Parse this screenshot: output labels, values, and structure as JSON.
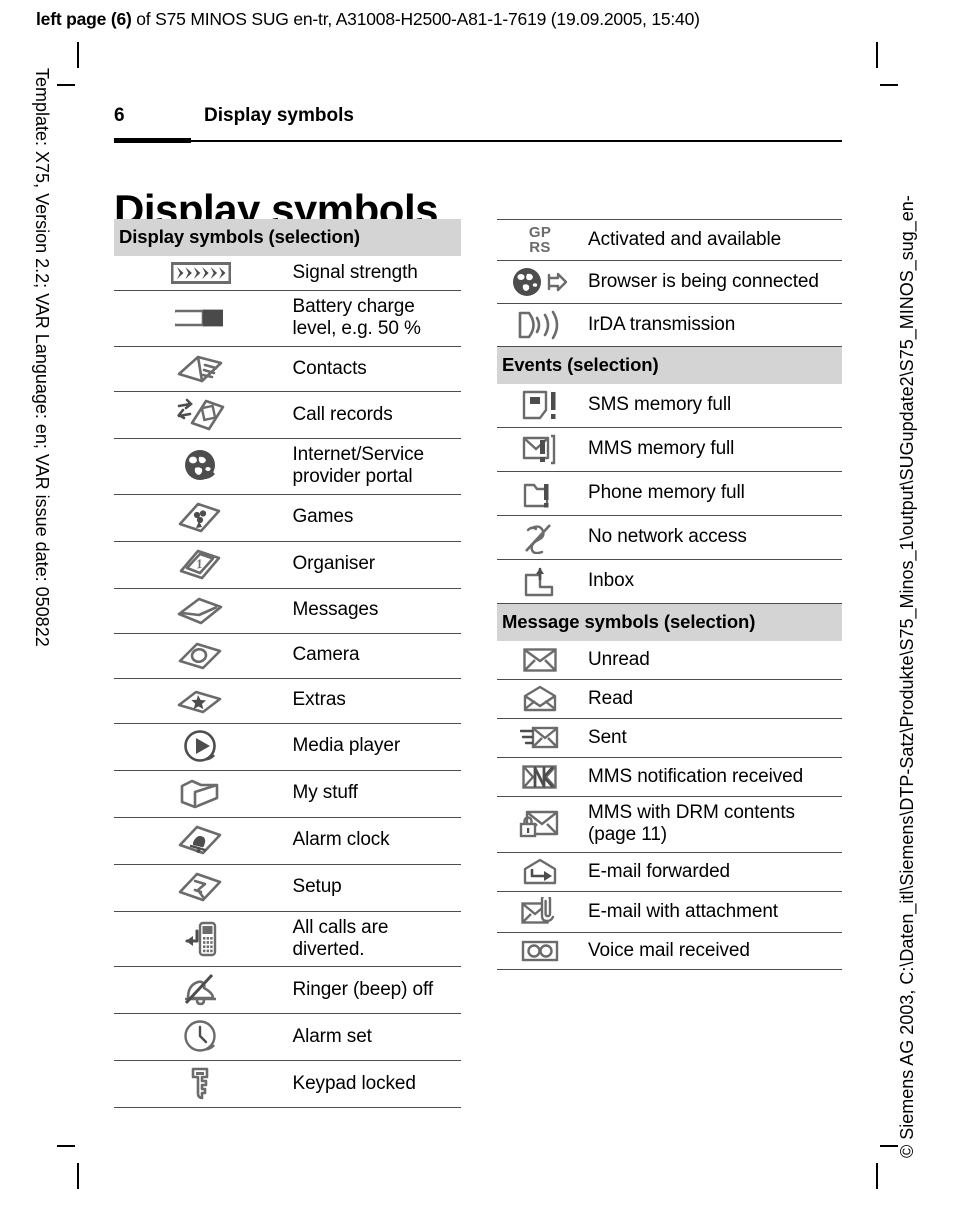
{
  "print_header": {
    "bold_prefix": "left page (6)",
    "rest": " of S75 MINOS SUG en-tr, A31008-H2500-A81-1-7619 (19.09.2005, 15:40)"
  },
  "side_text": {
    "left": "Template: X75, Version 2.2; VAR Language: en; VAR issue date: 050822",
    "right": "© Siemens AG 2003, C:\\Daten_itl\\Siemens\\DTP-Satz\\Produkte\\S75_Minos_1\\output\\SUGupdate2\\S75_MINOS_sug_en-"
  },
  "running_head": {
    "page_number": "6",
    "title": "Display symbols"
  },
  "chapter_title": "Display symbols",
  "colors": {
    "section_band": "#d4d4d4",
    "rule": "#4d4d4d",
    "icon_gray": "#6b6b6b",
    "icon_dark": "#4d4d4d"
  },
  "left_column": {
    "sections": [
      {
        "heading": "Display symbols (selection)",
        "rows": [
          {
            "icon": "signal-strength-icon",
            "label": "Signal strength"
          },
          {
            "icon": "battery-half-icon",
            "label": "Battery charge level, e.g. 50 %"
          },
          {
            "icon": "contacts-icon",
            "label": "Contacts"
          },
          {
            "icon": "call-records-icon",
            "label": "Call records"
          },
          {
            "icon": "globe-icon",
            "label": "Internet/Service provider portal"
          },
          {
            "icon": "games-icon",
            "label": "Games"
          },
          {
            "icon": "organiser-icon",
            "label": "Organiser"
          },
          {
            "icon": "messages-icon",
            "label": "Messages"
          },
          {
            "icon": "camera-icon",
            "label": "Camera"
          },
          {
            "icon": "extras-icon",
            "label": "Extras"
          },
          {
            "icon": "media-player-icon",
            "label": "Media player"
          },
          {
            "icon": "my-stuff-icon",
            "label": "My stuff"
          },
          {
            "icon": "alarm-clock-icon",
            "label": "Alarm clock"
          },
          {
            "icon": "setup-icon",
            "label": "Setup"
          },
          {
            "icon": "call-diverted-icon",
            "label": "All calls are diverted."
          },
          {
            "icon": "ringer-off-icon",
            "label": "Ringer (beep) off"
          },
          {
            "icon": "alarm-set-icon",
            "label": "Alarm set"
          },
          {
            "icon": "keypad-locked-icon",
            "label": "Keypad locked"
          }
        ]
      }
    ]
  },
  "right_column": {
    "sections": [
      {
        "heading": null,
        "rows": [
          {
            "icon": "gprs-icon",
            "icon_text": "GP\nRS",
            "label": "Activated and available"
          },
          {
            "icon": "browser-connecting-icon",
            "label": "Browser is being connected"
          },
          {
            "icon": "irda-icon",
            "label": "IrDA transmission"
          }
        ]
      },
      {
        "heading": "Events (selection)",
        "rows": [
          {
            "icon": "sms-memory-full-icon",
            "label": "SMS memory full"
          },
          {
            "icon": "mms-memory-full-icon",
            "label": "MMS memory full"
          },
          {
            "icon": "phone-memory-full-icon",
            "label": "Phone memory full"
          },
          {
            "icon": "no-network-icon",
            "label": "No network access"
          },
          {
            "icon": "inbox-icon",
            "label": "Inbox"
          }
        ]
      },
      {
        "heading": "Message symbols (selection)",
        "rows": [
          {
            "icon": "unread-envelope-icon",
            "label": "Unread"
          },
          {
            "icon": "read-envelope-icon",
            "label": "Read"
          },
          {
            "icon": "sent-envelope-icon",
            "label": "Sent"
          },
          {
            "icon": "mms-notification-icon",
            "label": "MMS notification received"
          },
          {
            "icon": "mms-drm-icon",
            "label": "MMS with DRM contents\n(page 11)"
          },
          {
            "icon": "email-forwarded-icon",
            "label": "E-mail forwarded"
          },
          {
            "icon": "email-attachment-icon",
            "label": "E-mail with attachment"
          },
          {
            "icon": "voice-mail-icon",
            "label": "Voice mail received"
          }
        ]
      }
    ]
  }
}
